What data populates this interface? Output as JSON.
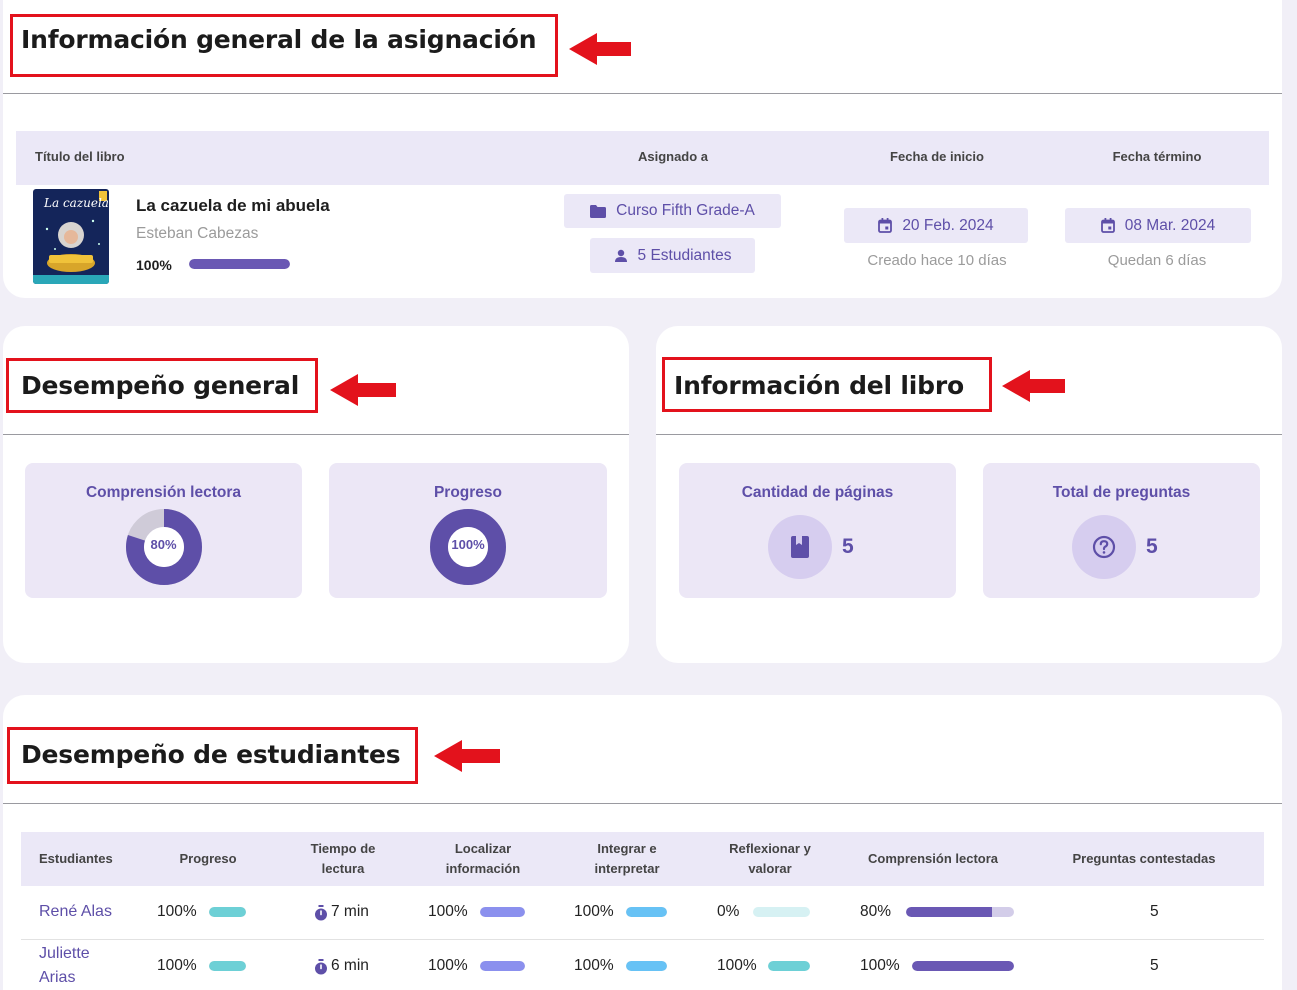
{
  "assignment": {
    "section_title": "Información general de la asignación",
    "headers": {
      "book_title": "Título del libro",
      "assigned_to": "Asignado a",
      "start_date": "Fecha de inicio",
      "end_date": "Fecha término"
    },
    "book": {
      "title": "La cazuela de mi abuela",
      "author": "Esteban Cabezas",
      "progress_label": "100%",
      "progress_value": 100,
      "cover_text": "La cazuela"
    },
    "course_chip": "Curso Fifth Grade-A",
    "students_chip": "5 Estudiantes",
    "start_date": "20 Feb. 2024",
    "start_note": "Creado hace 10 días",
    "end_date": "08 Mar. 2024",
    "end_note": "Quedan 6 días"
  },
  "performance": {
    "section_title": "Desempeño general",
    "reading_comprehension": {
      "label": "Comprensión lectora",
      "value_label": "80%",
      "value": 80
    },
    "progress": {
      "label": "Progreso",
      "value_label": "100%",
      "value": 100
    }
  },
  "book_info": {
    "section_title": "Información del libro",
    "pages": {
      "label": "Cantidad de páginas",
      "value": "5",
      "icon": "book-icon"
    },
    "questions": {
      "label": "Total de preguntas",
      "value": "5",
      "icon": "help-circle-icon"
    }
  },
  "students": {
    "section_title": "Desempeño de estudiantes",
    "headers": {
      "student": "Estudiantes",
      "progress": "Progreso",
      "reading_time_1": "Tiempo de",
      "reading_time_2": "lectura",
      "locate_1": "Localizar",
      "locate_2": "información",
      "integrate_1": "Integrar e",
      "integrate_2": "interpretar",
      "reflect_1": "Reflexionar y",
      "reflect_2": "valorar",
      "comprehension": "Comprensión lectora",
      "answered": "Preguntas contestadas"
    },
    "rows": [
      {
        "name": "René Alas",
        "progress": "100%",
        "progress_value": 100,
        "time": "7 min",
        "locate": "100%",
        "locate_value": 100,
        "integrate": "100%",
        "integrate_value": 100,
        "reflect": "0%",
        "reflect_value": 0,
        "comprehension": "80%",
        "comprehension_value": 80,
        "answered": "5"
      },
      {
        "name": "Juliette Arias",
        "progress": "100%",
        "progress_value": 100,
        "time": "6 min",
        "locate": "100%",
        "locate_value": 100,
        "integrate": "100%",
        "integrate_value": 100,
        "reflect": "100%",
        "reflect_value": 100,
        "comprehension": "100%",
        "comprehension_value": 100,
        "answered": "5"
      }
    ]
  },
  "colors": {
    "accent": "#5e4fa8",
    "highlight": "#e3121c",
    "progress_bar": "#6dd0d6",
    "locate_bar": "#8b90ee",
    "integrate_bar": "#67c2f5",
    "comprehension_bar": "#6a58b4"
  }
}
